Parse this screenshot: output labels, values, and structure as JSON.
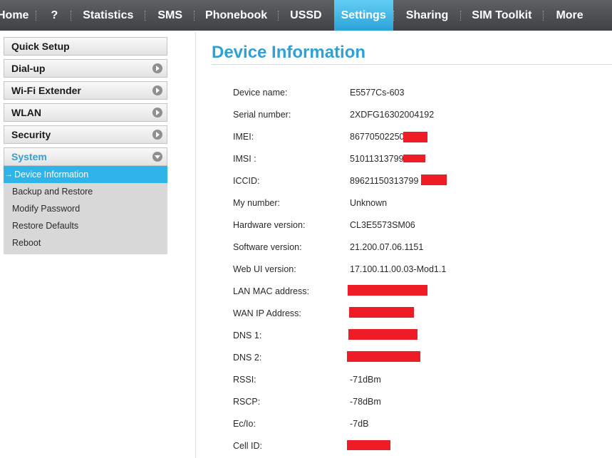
{
  "nav": {
    "items": [
      {
        "label": "Home"
      },
      {
        "label": "?"
      },
      {
        "label": "Statistics"
      },
      {
        "label": "SMS"
      },
      {
        "label": "Phonebook"
      },
      {
        "label": "USSD"
      },
      {
        "label": "Settings",
        "active": true
      },
      {
        "label": "Sharing"
      },
      {
        "label": "SIM Toolkit"
      },
      {
        "label": "More"
      }
    ],
    "active_color": "#2ba3d8",
    "bar_color": "#4a4d4f"
  },
  "sidebar": {
    "items": [
      {
        "label": "Quick Setup"
      },
      {
        "label": "Dial-up",
        "icon": "chevron-right-icon"
      },
      {
        "label": "Wi-Fi Extender",
        "icon": "chevron-right-icon"
      },
      {
        "label": "WLAN",
        "icon": "chevron-right-icon"
      },
      {
        "label": "Security",
        "icon": "chevron-right-icon"
      },
      {
        "label": "System",
        "icon": "chevron-down-icon",
        "expanded": true
      }
    ],
    "submenu": [
      {
        "label": "Device Information",
        "active": true
      },
      {
        "label": "Backup and Restore"
      },
      {
        "label": "Modify Password"
      },
      {
        "label": "Restore Defaults"
      },
      {
        "label": "Reboot"
      }
    ],
    "active_marker": "→"
  },
  "main": {
    "title": "Device Information",
    "title_color": "#2ea1d6",
    "rows": [
      {
        "label": "Device name:",
        "value": "E5577Cs-603"
      },
      {
        "label": "Serial number:",
        "value": "2XDFG16302004192"
      },
      {
        "label": "IMEI:",
        "value": "86770502250",
        "redacted": true
      },
      {
        "label": "IMSI :",
        "value": "51011313799",
        "redacted": true
      },
      {
        "label": "ICCID:",
        "value": "89621150313799",
        "redacted": true
      },
      {
        "label": "My number:",
        "value": "Unknown"
      },
      {
        "label": "Hardware version:",
        "value": "CL3E5573SM06"
      },
      {
        "label": "Software version:",
        "value": "21.200.07.06.1151"
      },
      {
        "label": "Web UI version:",
        "value": "17.100.11.00.03-Mod1.1"
      },
      {
        "label": "LAN MAC address:",
        "value": "",
        "redacted": true
      },
      {
        "label": "WAN IP Address:",
        "value": "",
        "redacted": true
      },
      {
        "label": "DNS 1:",
        "value": "",
        "redacted": true
      },
      {
        "label": "DNS 2:",
        "value": "",
        "redacted": true
      },
      {
        "label": "RSSI:",
        "value": "-71dBm"
      },
      {
        "label": "RSCP:",
        "value": "-78dBm"
      },
      {
        "label": "Ec/Io:",
        "value": "-7dB"
      },
      {
        "label": "Cell ID:",
        "value": "",
        "redacted": true
      }
    ],
    "redaction_color": "#ee1c25"
  }
}
